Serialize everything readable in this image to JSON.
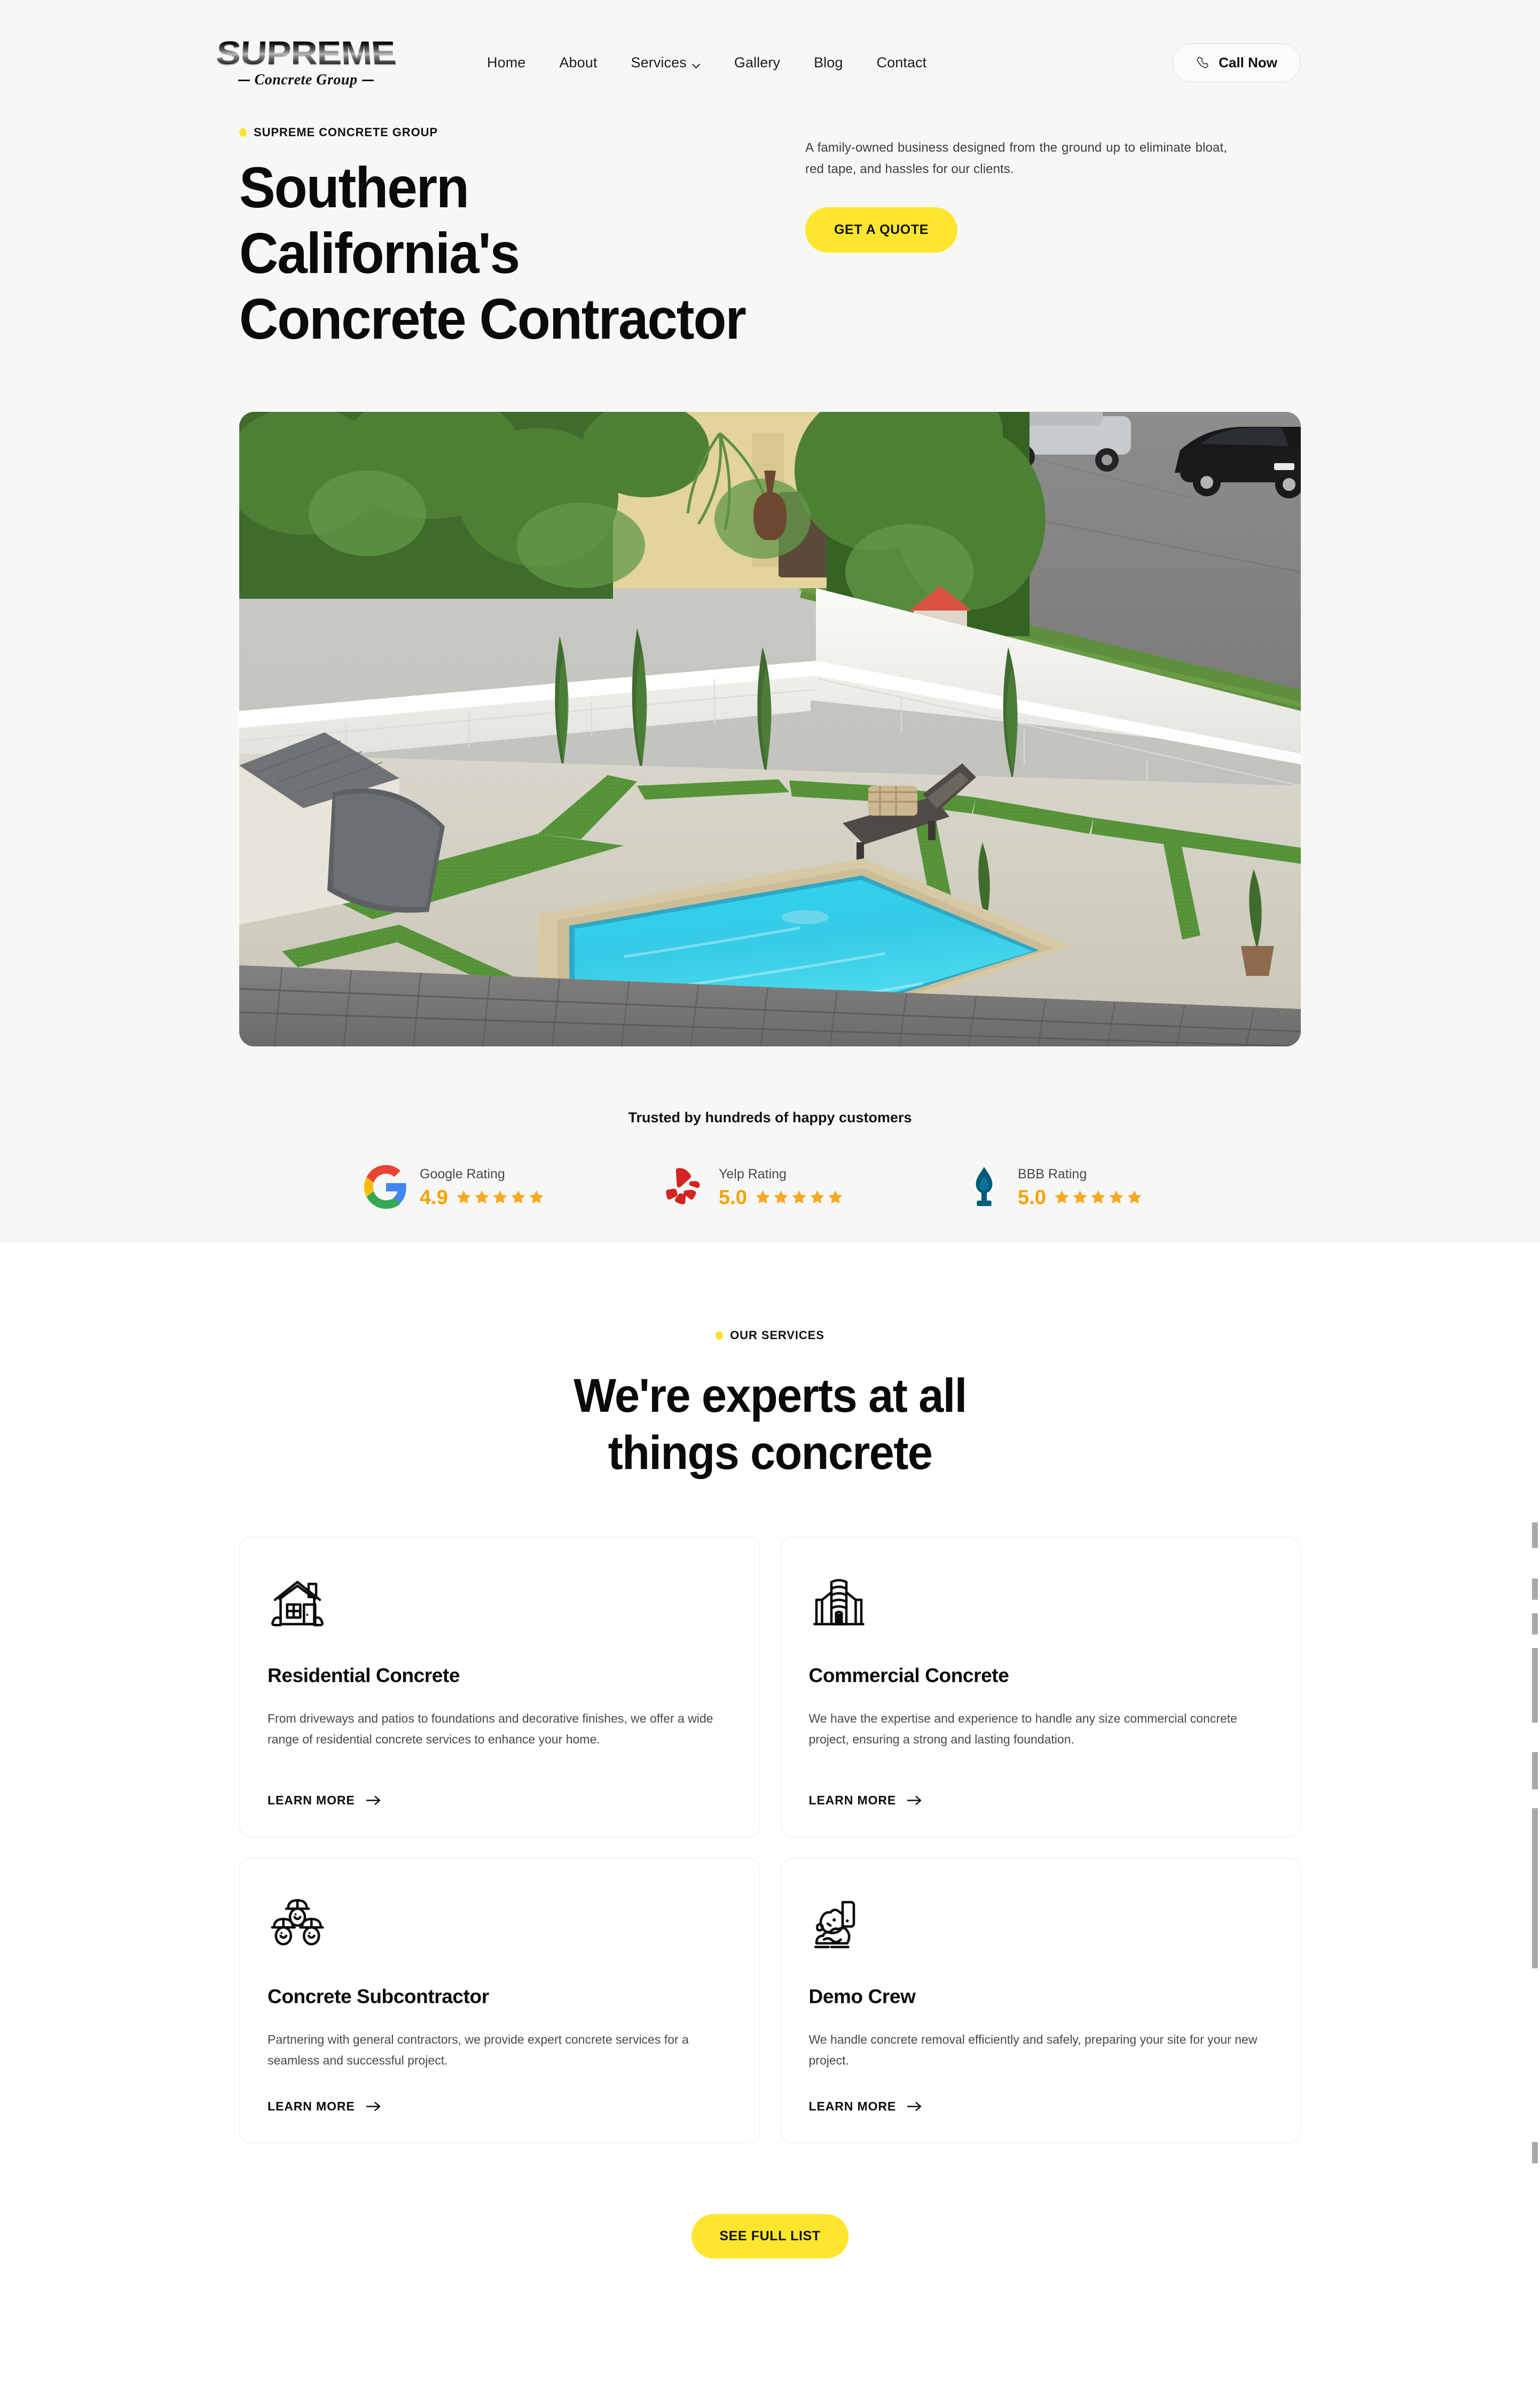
{
  "brand": {
    "logo_word": "SUPREME",
    "logo_script": "Concrete Group",
    "accent_yellow": "#ffe62e",
    "star_color": "#f9a825",
    "hero_bg": "#f7f8f6"
  },
  "header": {
    "nav": [
      {
        "label": "Home",
        "has_dropdown": false
      },
      {
        "label": "About",
        "has_dropdown": false
      },
      {
        "label": "Services",
        "has_dropdown": true
      },
      {
        "label": "Gallery",
        "has_dropdown": false
      },
      {
        "label": "Blog",
        "has_dropdown": false
      },
      {
        "label": "Contact",
        "has_dropdown": false
      }
    ],
    "call_button": {
      "label": "Call Now",
      "icon": "phone-icon"
    }
  },
  "hero": {
    "eyebrow": "SUPREME CONCRETE GROUP",
    "title_line1": "Southern California's",
    "title_line2": "Concrete Contractor",
    "description": "A family-owned business designed from the ground up to eliminate bloat, red tape, and hassles for our clients.",
    "cta_label": "GET A QUOTE",
    "image_alt": "Backyard swimming pool with concrete paver patio, artificial turf inlays, white block wall and landscaping"
  },
  "trust": {
    "title": "Trusted by hundreds of happy customers",
    "ratings": [
      {
        "icon": "google-icon",
        "label": "Google Rating",
        "score": "4.9",
        "stars": 5
      },
      {
        "icon": "yelp-icon",
        "label": "Yelp Rating",
        "score": "5.0",
        "stars": 5
      },
      {
        "icon": "bbb-icon",
        "label": "BBB Rating",
        "score": "5.0",
        "stars": 5
      }
    ]
  },
  "services": {
    "eyebrow": "OUR SERVICES",
    "heading_line1": "We're experts at all",
    "heading_line2": "things concrete",
    "learn_more_label": "LEARN MORE",
    "cards": [
      {
        "icon": "house-icon",
        "title": "Residential Concrete",
        "description": "From driveways and patios to foundations and decorative finishes, we offer a wide range of residential concrete services to enhance your home."
      },
      {
        "icon": "office-building-icon",
        "title": "Commercial Concrete",
        "description": "We have the expertise and experience to handle any size commercial concrete project, ensuring a strong and lasting foundation."
      },
      {
        "icon": "hardhat-workers-icon",
        "title": "Concrete Subcontractor",
        "description": "Partnering with general contractors, we provide expert concrete services for a seamless and successful project."
      },
      {
        "icon": "demolition-icon",
        "title": "Demo Crew",
        "description": "We handle concrete removal efficiently and safely, preparing your site for your new project."
      }
    ],
    "full_list_label": "SEE FULL LIST"
  }
}
